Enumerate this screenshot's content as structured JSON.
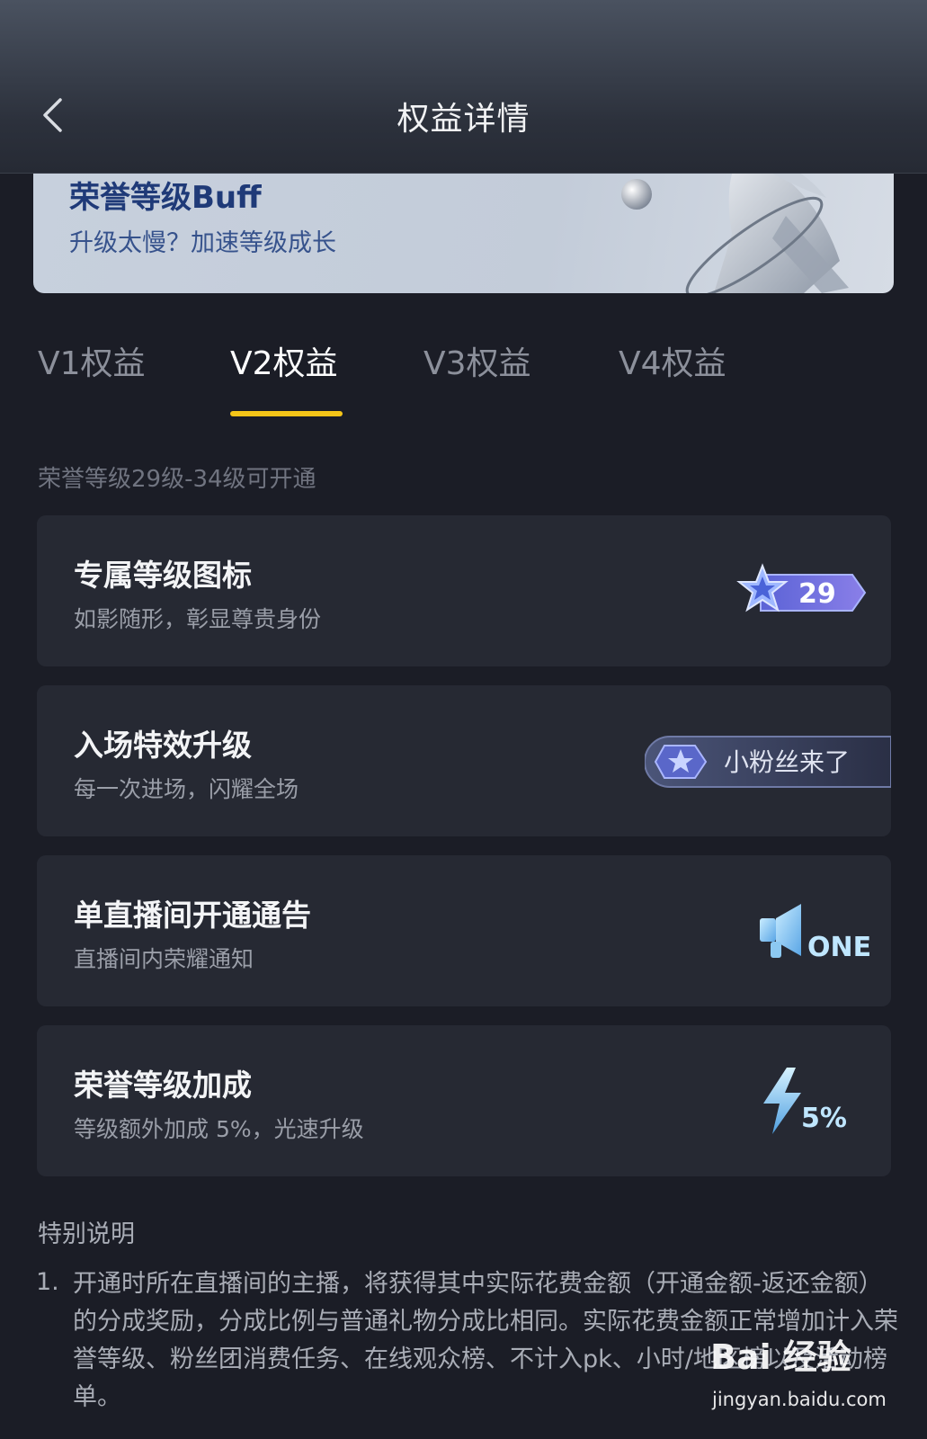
{
  "header": {
    "title": "权益详情",
    "back_icon": "chevron-left-icon"
  },
  "banner": {
    "title": "荣誉等级Buff",
    "subtitle": "升级太慢？加速等级成长",
    "art_icon": "rocket-icon"
  },
  "tabs": [
    {
      "label": "V1权益",
      "active": false
    },
    {
      "label": "V2权益",
      "active": true
    },
    {
      "label": "V3权益",
      "active": false
    },
    {
      "label": "V4权益",
      "active": false
    }
  ],
  "tab_accent": "#f5c518",
  "level_note": "荣誉等级29级-34级可开通",
  "benefits": [
    {
      "title": "专属等级图标",
      "subtitle": "如影随形，彰显尊贵身份",
      "icon": "level-badge-icon",
      "badge_value": "29"
    },
    {
      "title": "入场特效升级",
      "subtitle": "每一次进场，闪耀全场",
      "icon": "entrance-banner-icon",
      "badge_text": "小粉丝来了"
    },
    {
      "title": "单直播间开通通告",
      "subtitle": "直播间内荣耀通知",
      "icon": "megaphone-icon",
      "badge_text": "ONE"
    },
    {
      "title": "荣誉等级加成",
      "subtitle": "等级额外加成 5%，光速升级",
      "icon": "lightning-icon",
      "badge_text": "5%"
    }
  ],
  "notes": {
    "title": "特别说明",
    "items": [
      {
        "num": "1.",
        "text": "开通时所在直播间的主播，将获得其中实际花费金额（开通金额-返还金额）的分成奖励，分成比例与普通礼物分成比相同。实际花费金额正常增加计入荣誉等级、粉丝团消费任务、在线观众榜、不计入pk、小时/地区榜以及活动榜单。"
      }
    ]
  },
  "watermark": {
    "logo": "Bai 经验",
    "url": "jingyan.baidu.com"
  }
}
